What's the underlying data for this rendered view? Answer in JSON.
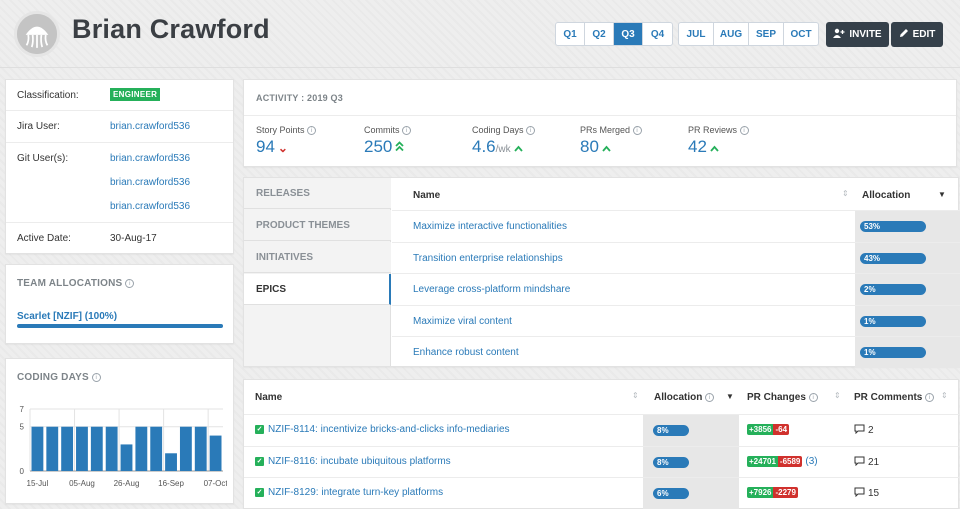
{
  "header": {
    "user_name": "Brian Crawford",
    "quarters": [
      {
        "label": "Q1",
        "active": false
      },
      {
        "label": "Q2",
        "active": false
      },
      {
        "label": "Q3",
        "active": true
      },
      {
        "label": "Q4",
        "active": false
      }
    ],
    "months": [
      "JUL",
      "AUG",
      "SEP",
      "OCT"
    ],
    "invite_label": "INVITE",
    "edit_label": "EDIT"
  },
  "profile": {
    "classification_label": "Classification:",
    "classification_badge": "ENGINEER",
    "jira_label": "Jira User:",
    "jira_user": "brian.crawford536",
    "git_label": "Git User(s):",
    "git_users": [
      "brian.crawford536",
      "brian.crawford536",
      "brian.crawford536"
    ],
    "active_label": "Active Date:",
    "active_date": "30-Aug-17"
  },
  "team_allocations": {
    "title": "TEAM ALLOCATIONS",
    "team_label": "Scarlet [NZIF] (100%)",
    "team_percent": 100
  },
  "coding_days": {
    "title": "CODING DAYS"
  },
  "chart_data": {
    "type": "bar",
    "title": "CODING DAYS",
    "categories": [
      "15-Jul",
      "",
      "",
      "05-Aug",
      "",
      "",
      "26-Aug",
      "",
      "",
      "16-Sep",
      "",
      "",
      "07-Oct"
    ],
    "tick_labels": [
      "15-Jul",
      "05-Aug",
      "26-Aug",
      "16-Sep",
      "07-Oct"
    ],
    "values": [
      5,
      5,
      5,
      5,
      5,
      5,
      3,
      5,
      5,
      2,
      5,
      5,
      4
    ],
    "yticks": [
      0,
      5,
      7
    ],
    "ylim": [
      0,
      7
    ],
    "grid": true
  },
  "activity": {
    "title": "ACTIVITY : 2019 Q3",
    "metrics": [
      {
        "label": "Story Points",
        "value": "94",
        "unit": "",
        "trend": "down"
      },
      {
        "label": "Commits",
        "value": "250",
        "unit": "",
        "trend": "double-up"
      },
      {
        "label": "Coding Days",
        "value": "4.6",
        "unit": "/wk",
        "trend": "up"
      },
      {
        "label": "PRs Merged",
        "value": "80",
        "unit": "",
        "trend": "up"
      },
      {
        "label": "PR Reviews",
        "value": "42",
        "unit": "",
        "trend": "up"
      }
    ]
  },
  "tabs": [
    "RELEASES",
    "PRODUCT THEMES",
    "INITIATIVES",
    "EPICS"
  ],
  "active_tab": "EPICS",
  "epics": {
    "col_name": "Name",
    "col_alloc": "Allocation",
    "rows": [
      {
        "name": "Maximize interactive functionalities",
        "alloc": "53%",
        "pct": 100
      },
      {
        "name": "Transition enterprise relationships",
        "alloc": "43%",
        "pct": 100
      },
      {
        "name": "Leverage cross-platform mindshare",
        "alloc": "2%",
        "pct": 100
      },
      {
        "name": "Maximize viral content",
        "alloc": "1%",
        "pct": 100
      },
      {
        "name": "Enhance robust content",
        "alloc": "1%",
        "pct": 100
      }
    ]
  },
  "issues": {
    "col_name": "Name",
    "col_alloc": "Allocation",
    "col_pr": "PR Changes",
    "col_comments": "PR Comments",
    "rows": [
      {
        "name": "NZIF-8114: incentivize bricks-and-clicks info-mediaries",
        "alloc": "8%",
        "add": "+3856",
        "del": "-64",
        "extra": "",
        "comments": "2"
      },
      {
        "name": "NZIF-8116: incubate ubiquitous platforms",
        "alloc": "8%",
        "add": "+24701",
        "del": "-6589",
        "extra": "(3)",
        "comments": "21"
      },
      {
        "name": "NZIF-8129: integrate turn-key platforms",
        "alloc": "6%",
        "add": "+7926",
        "del": "-2279",
        "extra": "",
        "comments": "15"
      }
    ]
  },
  "colors": {
    "accent": "#2a7ab8",
    "dark": "#35404a",
    "green": "#25b05a",
    "red": "#d0312d"
  }
}
